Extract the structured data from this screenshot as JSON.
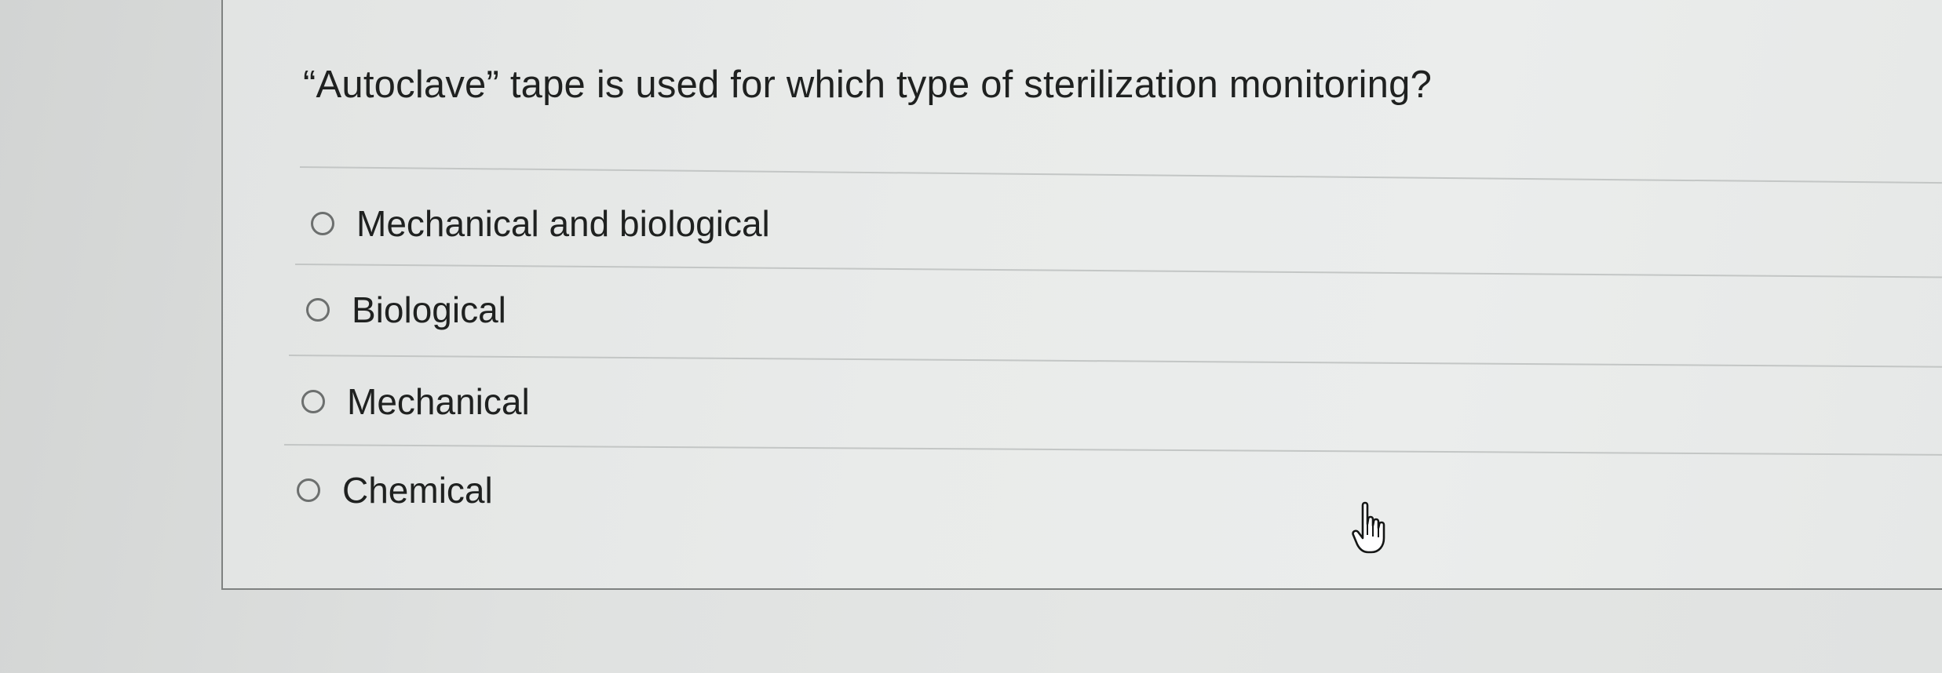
{
  "question": {
    "text": "“Autoclave” tape is used for which type of sterilization monitoring?"
  },
  "options": [
    {
      "label": "Mechanical and biological",
      "selected": false
    },
    {
      "label": "Biological",
      "selected": false
    },
    {
      "label": "Mechanical",
      "selected": false
    },
    {
      "label": "Chemical",
      "selected": false
    }
  ],
  "cursor": {
    "icon": "hand-pointer-icon"
  },
  "colors": {
    "background": "#d9dbda",
    "card": "#e9ebea",
    "text": "#1f2120",
    "radio_border": "#6c6f6e",
    "divider": "#c3c6c5"
  }
}
